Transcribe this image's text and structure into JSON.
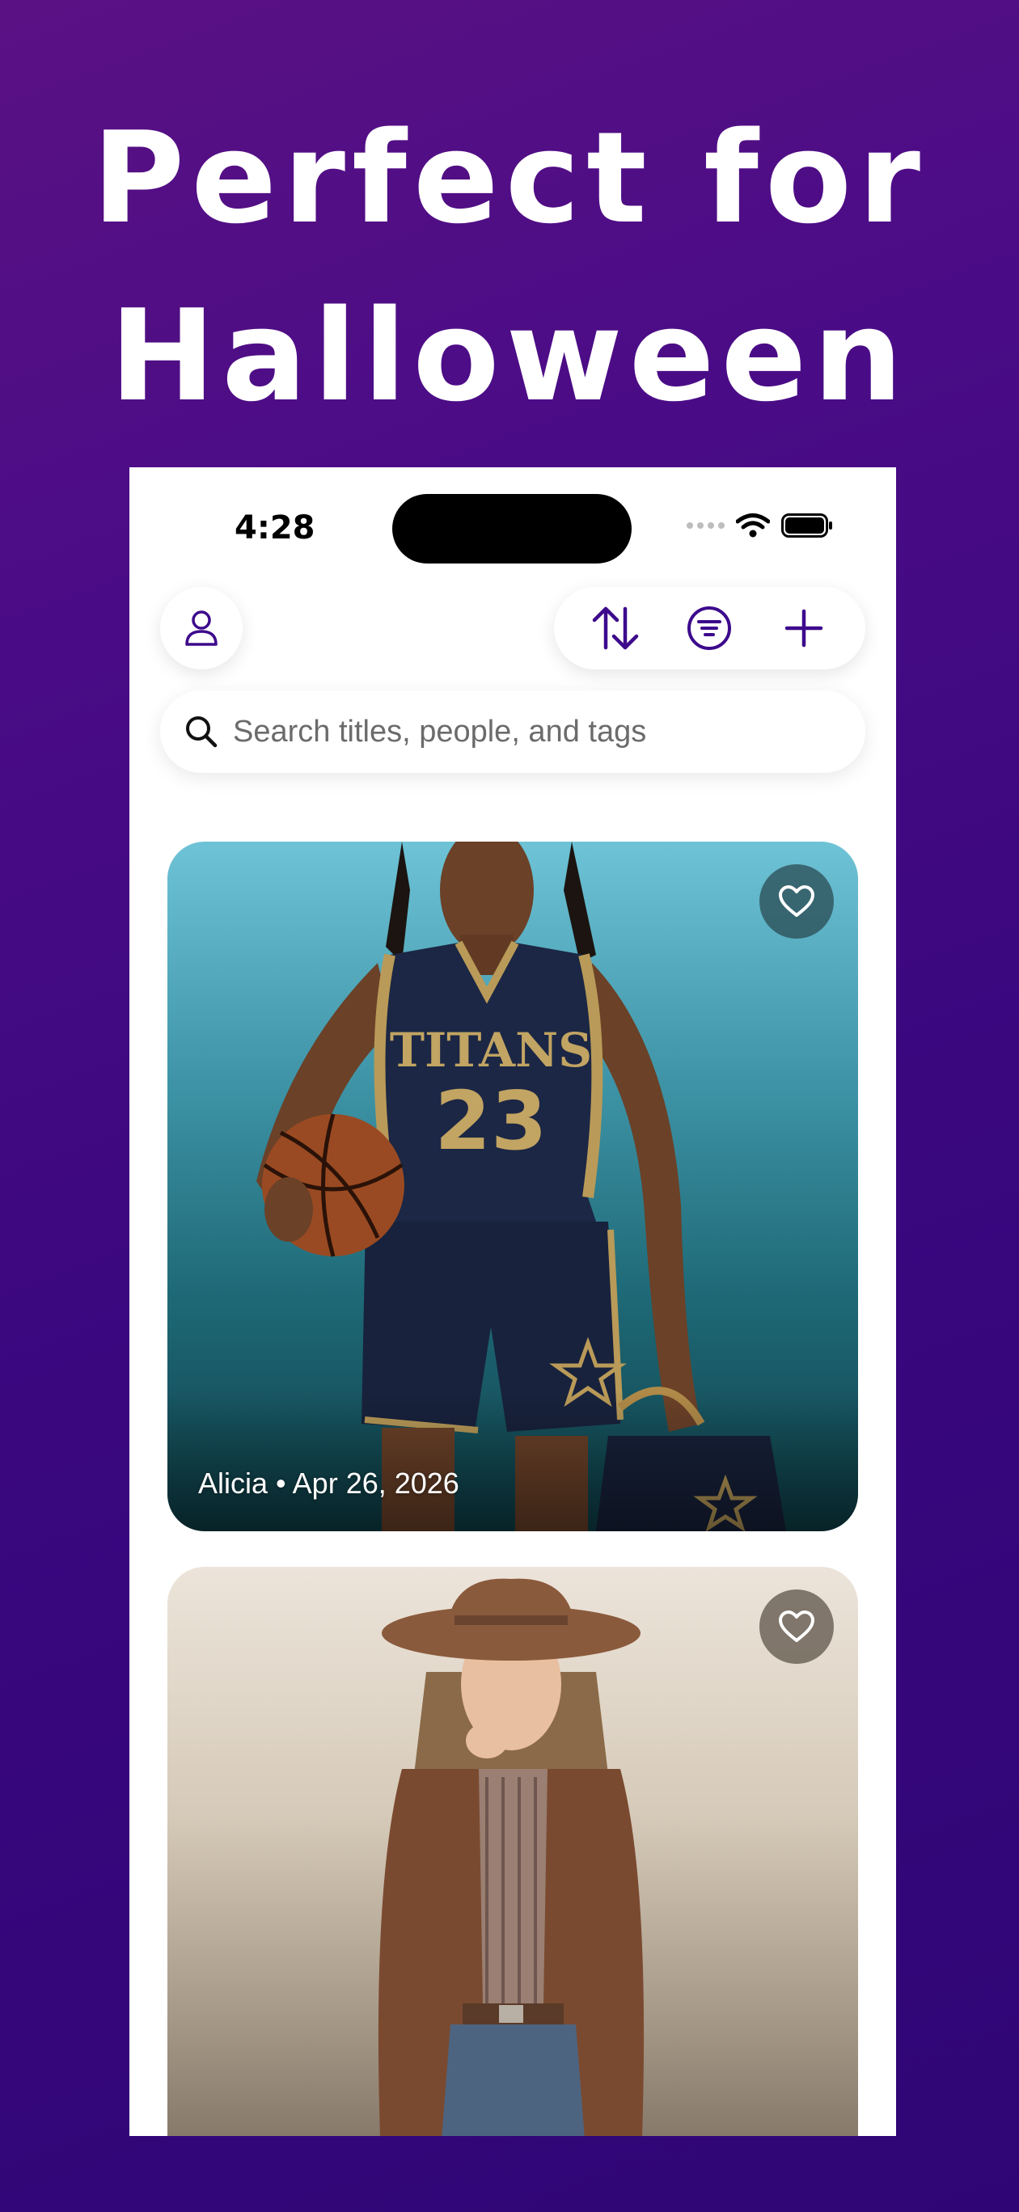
{
  "headline": {
    "line1": "Perfect for",
    "line2": "Halloween"
  },
  "status_bar": {
    "time": "4:28"
  },
  "toolbar": {
    "profile_icon": "person-icon",
    "sort_icon": "sort-arrows-icon",
    "filter_icon": "filter-circle-icon",
    "add_icon": "plus-icon",
    "accent_color": "#3d0a8c"
  },
  "search": {
    "placeholder": "Search titles, people, and tags"
  },
  "cards": [
    {
      "name": "Alicia",
      "separator": "•",
      "date": "Apr 26, 2026",
      "favorite_icon": "heart-icon",
      "subject": "basketball player in navy TITANS 23 jersey"
    },
    {
      "favorite_icon": "heart-icon",
      "subject": "woman in cowboy hat and brown leather jacket"
    }
  ],
  "jersey": {
    "team": "TITANS",
    "number": "23"
  }
}
